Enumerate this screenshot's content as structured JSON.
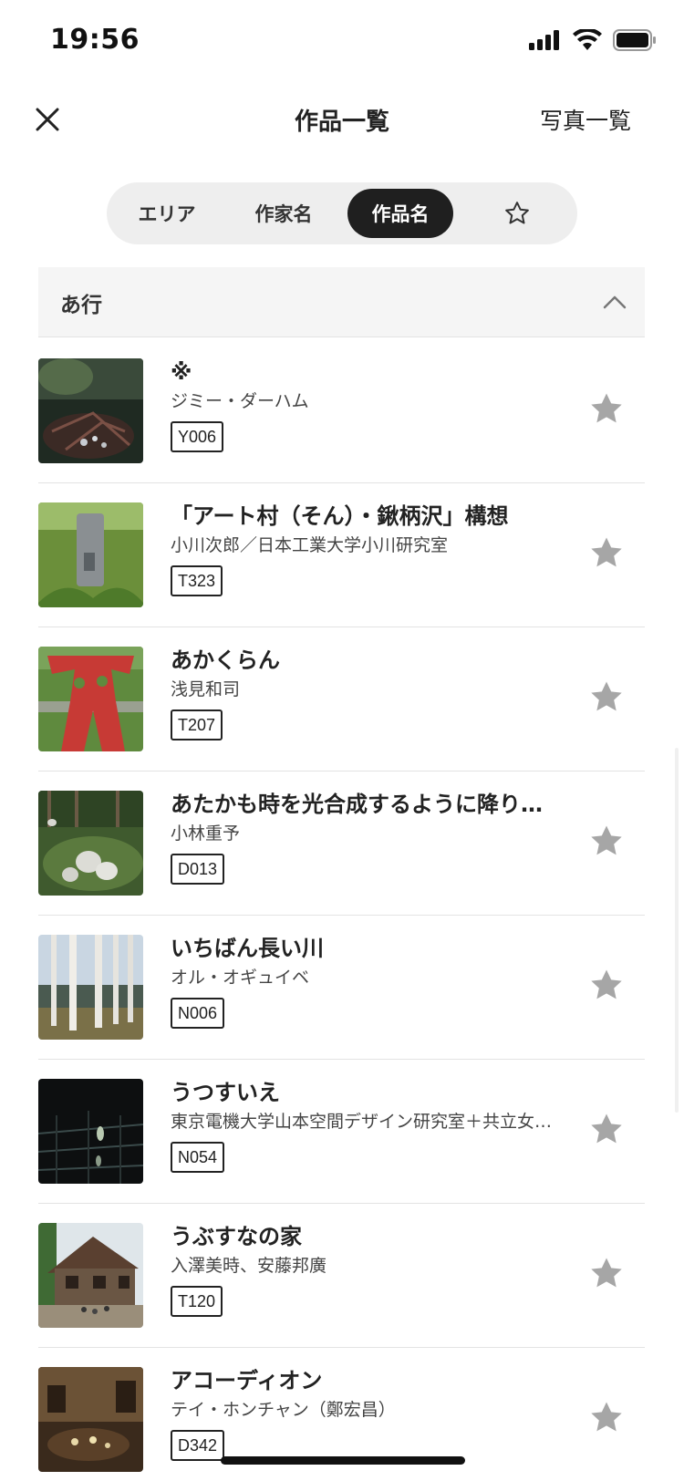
{
  "status_bar": {
    "time": "19:56"
  },
  "nav": {
    "title": "作品一覧",
    "photo_list": "写真一覧"
  },
  "tabs": [
    {
      "label": "エリア",
      "active": false
    },
    {
      "label": "作家名",
      "active": false
    },
    {
      "label": "作品名",
      "active": true
    },
    {
      "label": "",
      "icon": "star-outline-icon",
      "active": false
    }
  ],
  "section": {
    "title": "あ行",
    "expanded": true
  },
  "works": [
    {
      "title": "※",
      "artist": "ジミー・ダーハム",
      "code": "Y006",
      "thumb": "dark-forest"
    },
    {
      "title": "「アート村（そん）・鍬柄沢」構想",
      "artist": "小川次郎／日本工業大学小川研究室",
      "code": "T323",
      "thumb": "stone-sculpture"
    },
    {
      "title": "あかくらん",
      "artist": "浅見和司",
      "code": "T207",
      "thumb": "red-sculpture"
    },
    {
      "title": "あたかも時を光合成するように降り…",
      "artist": "小林重予",
      "code": "D013",
      "thumb": "white-pods"
    },
    {
      "title": "いちばん長い川",
      "artist": "オル・オギュイベ",
      "code": "N006",
      "thumb": "white-poles"
    },
    {
      "title": "うつすいえ",
      "artist": "東京電機大学山本空間デザイン研究室＋共立女…",
      "code": "N054",
      "thumb": "dark-interior"
    },
    {
      "title": "うぶすなの家",
      "artist": "入澤美時、安藤邦廣",
      "code": "T120",
      "thumb": "thatched-house"
    },
    {
      "title": "アコーディオン",
      "artist": "テイ・ホンチャン（鄭宏昌）",
      "code": "D342",
      "thumb": "warm-room"
    }
  ],
  "colors": {
    "active_tab": "#1f1f1f",
    "star": "#a6a6a6",
    "section_bg": "#f5f5f5"
  }
}
